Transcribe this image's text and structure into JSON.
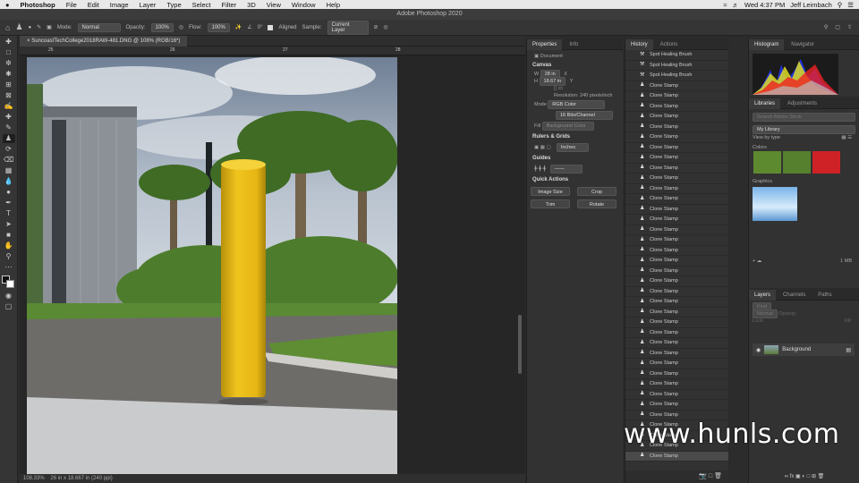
{
  "menubar": {
    "apple": "",
    "app": "Photoshop",
    "items": [
      "File",
      "Edit",
      "Image",
      "Layer",
      "Type",
      "Select",
      "Filter",
      "3D",
      "View",
      "Window",
      "Help"
    ],
    "clock": "Wed 4:37 PM",
    "user": "Jeff Leimbach"
  },
  "window_title": "Adobe Photoshop 2020",
  "options": {
    "mode_label": "Mode:",
    "mode_value": "Normal",
    "opacity_label": "Opacity:",
    "opacity_value": "100%",
    "flow_label": "Flow:",
    "flow_value": "100%",
    "angle_value": "0°",
    "aligned_label": "Aligned",
    "sample_label": "Sample:",
    "sample_value": "Current Layer"
  },
  "document_tab": "SuncoastTechCollege2018RAW-481.DNG @ 108% (RGB/16*)",
  "ruler_marks": [
    "25",
    "26",
    "27",
    "28"
  ],
  "status": {
    "zoom": "108.33%",
    "doc": "26 in x 18.667 in (240 ppi)"
  },
  "properties": {
    "tabs": [
      "Properties",
      "Info"
    ],
    "doc_label": "Document",
    "canvas_title": "Canvas",
    "w_label": "W",
    "w_value": "28 in",
    "h_label": "H",
    "h_value": "18.67 in",
    "x_label": "X",
    "y_label": "Y",
    "resolution": "Resolution: 240 pixels/inch",
    "mode_label": "Mode",
    "mode_value": "RGB Color",
    "bits_value": "16 Bits/Channel",
    "fill_label": "Fill",
    "fill_value": "Background Color",
    "rulers_title": "Rulers & Grids",
    "units_value": "Inches",
    "guides_title": "Guides",
    "quick_title": "Quick Actions",
    "btn_image_size": "Image Size",
    "btn_crop": "Crop",
    "btn_trim": "Trim",
    "btn_rotate": "Rotate"
  },
  "history": {
    "tabs": [
      "History",
      "Actions"
    ],
    "items": [
      "Spot Healing Brush",
      "Spot Healing Brush",
      "Spot Healing Brush",
      "Clone Stamp",
      "Clone Stamp",
      "Clone Stamp",
      "Clone Stamp",
      "Clone Stamp",
      "Clone Stamp",
      "Clone Stamp",
      "Clone Stamp",
      "Clone Stamp",
      "Clone Stamp",
      "Clone Stamp",
      "Clone Stamp",
      "Clone Stamp",
      "Clone Stamp",
      "Clone Stamp",
      "Clone Stamp",
      "Clone Stamp",
      "Clone Stamp",
      "Clone Stamp",
      "Clone Stamp",
      "Clone Stamp",
      "Clone Stamp",
      "Clone Stamp",
      "Clone Stamp",
      "Clone Stamp",
      "Clone Stamp",
      "Clone Stamp",
      "Clone Stamp",
      "Clone Stamp",
      "Clone Stamp",
      "Clone Stamp",
      "Clone Stamp",
      "Clone Stamp",
      "Clone Stamp",
      "Clone Stamp",
      "Clone Stamp",
      "Clone Stamp"
    ]
  },
  "histogram": {
    "tabs": [
      "Histogram",
      "Navigator"
    ]
  },
  "libraries": {
    "tabs": [
      "Libraries",
      "Adjustments"
    ],
    "search_placeholder": "Search Adobe Stock",
    "library_value": "My Library",
    "view_by": "View by type",
    "colors_title": "Colors",
    "colors": [
      "#5e8a2f",
      "#567f2e",
      "#cf2226"
    ],
    "graphics_title": "Graphics",
    "size_text": "1 MB"
  },
  "layers": {
    "tabs": [
      "Layers",
      "Channels",
      "Paths"
    ],
    "kind_placeholder": "Kind",
    "blend_value": "Normal",
    "opacity_label": "Opacity:",
    "lock_label": "Lock:",
    "fill_label": "Fill:",
    "layer_name": "Background"
  },
  "watermark": "www.hunls.com"
}
